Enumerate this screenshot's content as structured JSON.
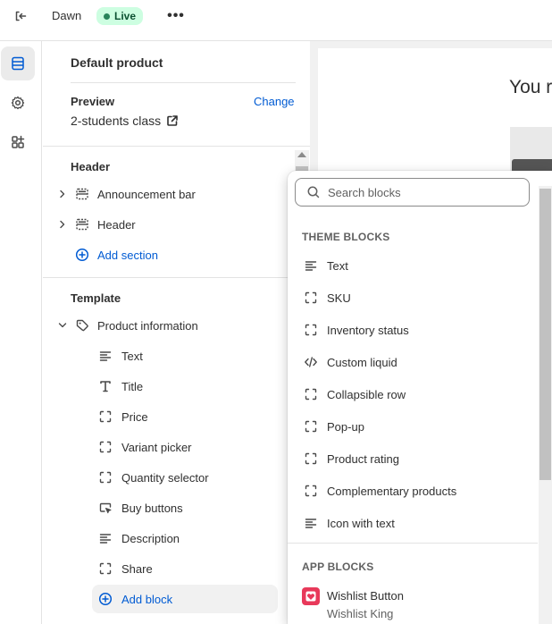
{
  "topbar": {
    "theme_name": "Dawn",
    "status_badge": "Live",
    "more_label": "•••"
  },
  "rail": {
    "items": [
      {
        "icon": "sections-icon",
        "active": true
      },
      {
        "icon": "gear-icon",
        "active": false
      },
      {
        "icon": "apps-icon",
        "active": false
      }
    ]
  },
  "sidebar": {
    "title": "Default product",
    "preview_label": "Preview",
    "change_label": "Change",
    "preview_value": "2-students class",
    "header_group": {
      "heading": "Header",
      "items": [
        {
          "label": "Announcement bar",
          "icon": "section-layout-icon"
        },
        {
          "label": "Header",
          "icon": "section-layout-icon"
        }
      ],
      "add_section_label": "Add section"
    },
    "template_group": {
      "heading": "Template",
      "section_label": "Product information",
      "blocks": [
        {
          "label": "Text",
          "icon": "text-lines-icon"
        },
        {
          "label": "Title",
          "icon": "title-t-icon"
        },
        {
          "label": "Price",
          "icon": "block-dashed-icon"
        },
        {
          "label": "Variant picker",
          "icon": "block-dashed-icon"
        },
        {
          "label": "Quantity selector",
          "icon": "block-dashed-icon"
        },
        {
          "label": "Buy buttons",
          "icon": "button-cursor-icon"
        },
        {
          "label": "Description",
          "icon": "text-lines-icon"
        },
        {
          "label": "Share",
          "icon": "block-dashed-icon"
        }
      ],
      "add_block_label": "Add block"
    }
  },
  "preview": {
    "heading": "You r"
  },
  "popover": {
    "search_placeholder": "Search blocks",
    "theme_blocks_label": "THEME BLOCKS",
    "theme_blocks": [
      {
        "label": "Text",
        "icon": "text-lines-icon"
      },
      {
        "label": "SKU",
        "icon": "block-dashed-icon"
      },
      {
        "label": "Inventory status",
        "icon": "block-dashed-icon"
      },
      {
        "label": "Custom liquid",
        "icon": "code-icon"
      },
      {
        "label": "Collapsible row",
        "icon": "block-dashed-icon"
      },
      {
        "label": "Pop-up",
        "icon": "block-dashed-icon"
      },
      {
        "label": "Product rating",
        "icon": "block-dashed-icon"
      },
      {
        "label": "Complementary products",
        "icon": "block-dashed-icon"
      },
      {
        "label": "Icon with text",
        "icon": "text-lines-icon"
      }
    ],
    "app_blocks_label": "APP BLOCKS",
    "app_blocks": [
      {
        "name": "Wishlist Button",
        "vendor": "Wishlist King",
        "icon": "heart-app-icon",
        "color": "#e8395a"
      }
    ]
  }
}
